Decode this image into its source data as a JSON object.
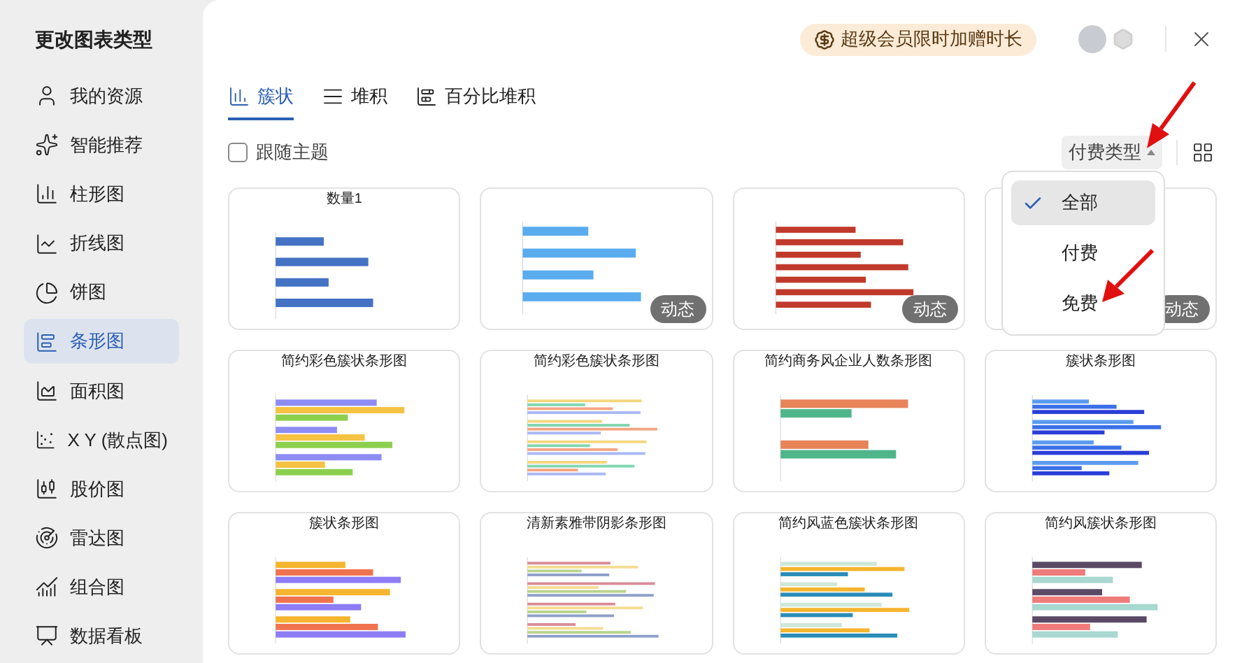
{
  "sidebar": {
    "title": "更改图表类型",
    "items": [
      {
        "label": "我的资源",
        "selected": false
      },
      {
        "label": "智能推荐",
        "selected": false
      },
      {
        "label": "柱形图",
        "selected": false
      },
      {
        "label": "折线图",
        "selected": false
      },
      {
        "label": "饼图",
        "selected": false
      },
      {
        "label": "条形图",
        "selected": true
      },
      {
        "label": "面积图",
        "selected": false
      },
      {
        "label": "X Y (散点图)",
        "selected": false
      },
      {
        "label": "股价图",
        "selected": false
      },
      {
        "label": "雷达图",
        "selected": false
      },
      {
        "label": "组合图",
        "selected": false
      },
      {
        "label": "数据看板",
        "selected": false
      }
    ]
  },
  "promo": {
    "label": "超级会员限时加赠时长"
  },
  "tabs": [
    {
      "label": "簇状",
      "selected": true
    },
    {
      "label": "堆积",
      "selected": false
    },
    {
      "label": "百分比堆积",
      "selected": false
    }
  ],
  "follow_theme": {
    "label": "跟随主题",
    "checked": false
  },
  "filter": {
    "label": "付费类型",
    "expanded": true
  },
  "filter_menu": [
    {
      "label": "全部",
      "selected": true
    },
    {
      "label": "付费",
      "selected": false
    },
    {
      "label": "免费",
      "selected": false
    }
  ],
  "cards": [
    {
      "title": "数量1"
    },
    {
      "badge": "动态"
    },
    {
      "badge": "动态"
    },
    {
      "badge": "动态"
    },
    {
      "title": "简约彩色簇状条形图"
    },
    {
      "title": "简约彩色簇状条形图"
    },
    {
      "title": "简约商务风企业人数条形图"
    },
    {
      "title": "簇状条形图"
    },
    {
      "title": "簇状条形图"
    },
    {
      "title": "清新素雅带阴影条形图"
    },
    {
      "title": "简约风蓝色簇状条形图"
    },
    {
      "title": "简约风簇状条形图"
    }
  ]
}
